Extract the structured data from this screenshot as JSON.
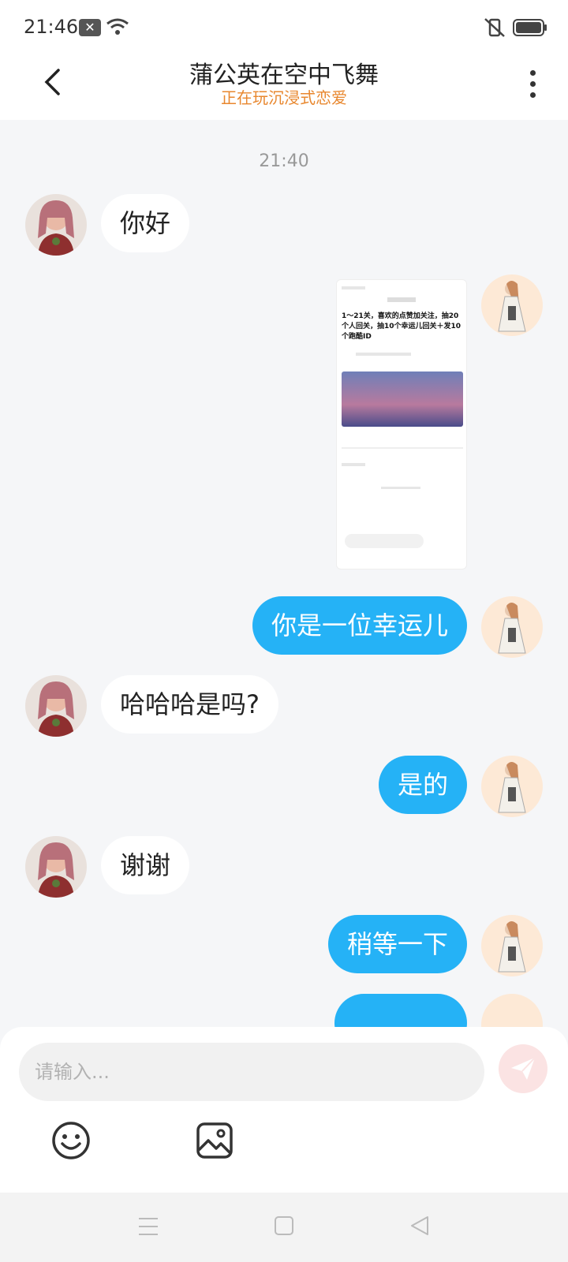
{
  "status_bar": {
    "time": "21:46"
  },
  "header": {
    "title": "蒲公英在空中飞舞",
    "subtitle": "正在玩沉浸式恋爱"
  },
  "colors": {
    "accent": "#25b2f6",
    "subtitle": "#e8872e",
    "background": "#f5f6f8"
  },
  "chat": {
    "timestamp": "21:40",
    "messages": [
      {
        "side": "left",
        "type": "text",
        "text": "你好"
      },
      {
        "side": "right",
        "type": "image",
        "text": ""
      },
      {
        "side": "right",
        "type": "text",
        "text": "你是一位幸运儿"
      },
      {
        "side": "left",
        "type": "text",
        "text": "哈哈哈是吗?"
      },
      {
        "side": "right",
        "type": "text",
        "text": "是的"
      },
      {
        "side": "left",
        "type": "text",
        "text": "谢谢"
      },
      {
        "side": "right",
        "type": "text",
        "text": "稍等一下"
      }
    ],
    "shared_post_title": "1～21关，喜欢的点赞加关注，抽20个人回关，抽10个幸运儿回关＋发10个跑酷ID"
  },
  "composer": {
    "placeholder": "请输入...",
    "send_icon": "paper-plane-icon",
    "emoji_icon": "smiley-icon",
    "image_icon": "image-icon"
  },
  "nav": {
    "menu_icon": "menu-icon",
    "home_icon": "square-home-icon",
    "back_icon": "triangle-back-icon"
  }
}
